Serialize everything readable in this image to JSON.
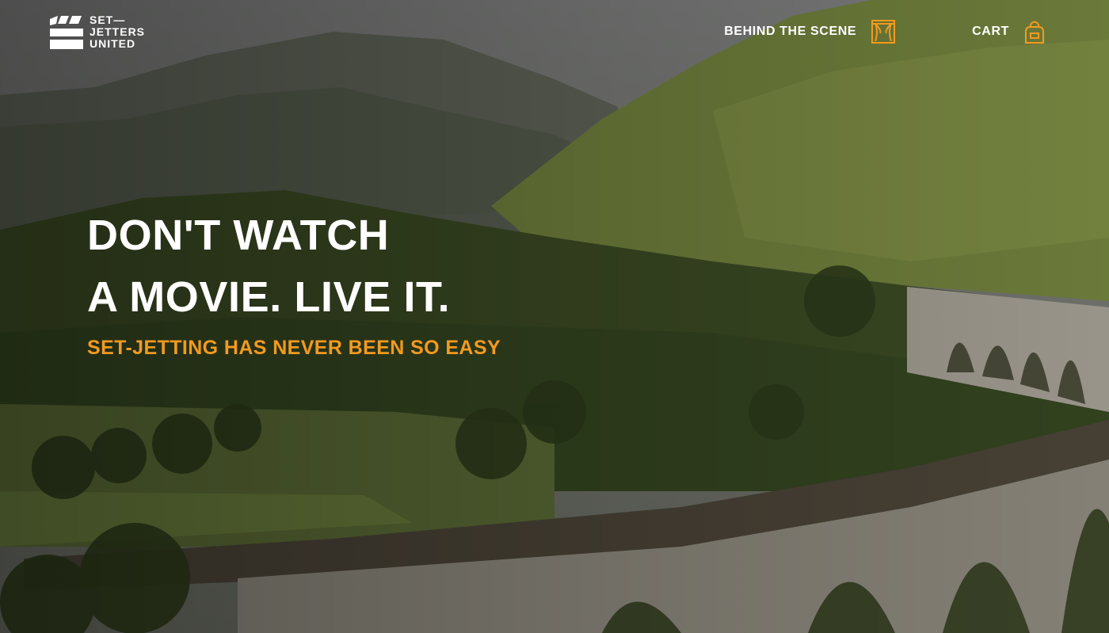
{
  "brand": {
    "lines": [
      "SET—",
      "JETTERS",
      "UNITED"
    ],
    "icon": "clapperboard-icon"
  },
  "nav": {
    "behind_the_scene": {
      "label": "BEHIND THE SCENE",
      "icon": "theater-curtain-icon"
    },
    "cart": {
      "label": "CART",
      "icon": "shopping-bag-icon"
    }
  },
  "hero": {
    "headline": [
      "DON'T WATCH",
      "A MOVIE. LIVE IT."
    ],
    "tagline": "SET-JETTING HAS NEVER BEEN SO EASY",
    "background": "hill-and-viaduct-photo"
  },
  "colors": {
    "accent": "#f39a1f",
    "text": "#ffffff"
  }
}
